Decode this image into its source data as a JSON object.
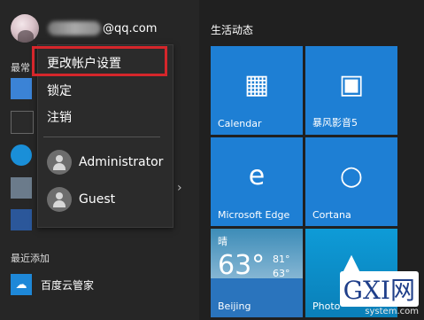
{
  "user": {
    "email_suffix": "@qq.com"
  },
  "sections": {
    "most_used": "最常",
    "recently_added": "最近添加"
  },
  "popup": {
    "change_account_settings": "更改帐户设置",
    "lock": "锁定",
    "sign_out": "注销",
    "users": [
      {
        "name": "Administrator"
      },
      {
        "name": "Guest"
      }
    ]
  },
  "recent": {
    "app": "百度云管家"
  },
  "tiles": {
    "group_title": "生活动态",
    "calendar": {
      "label": "Calendar",
      "icon": "calendar-icon"
    },
    "baofeng": {
      "label": "暴风影音5",
      "icon": "film-icon"
    },
    "edge": {
      "label": "Microsoft Edge",
      "icon": "edge-icon"
    },
    "cortana": {
      "label": "Cortana",
      "icon": "cortana-icon"
    },
    "weather": {
      "condition": "晴",
      "temp": "63°",
      "high": "81°",
      "low": "63°",
      "city": "Beijing"
    },
    "photos": {
      "label": "Photo"
    }
  },
  "watermark": {
    "logo": "GXI网",
    "sub": "system.com"
  },
  "colors": {
    "tile_blue": "#1e7fd4",
    "highlight_red": "#d5262b"
  }
}
